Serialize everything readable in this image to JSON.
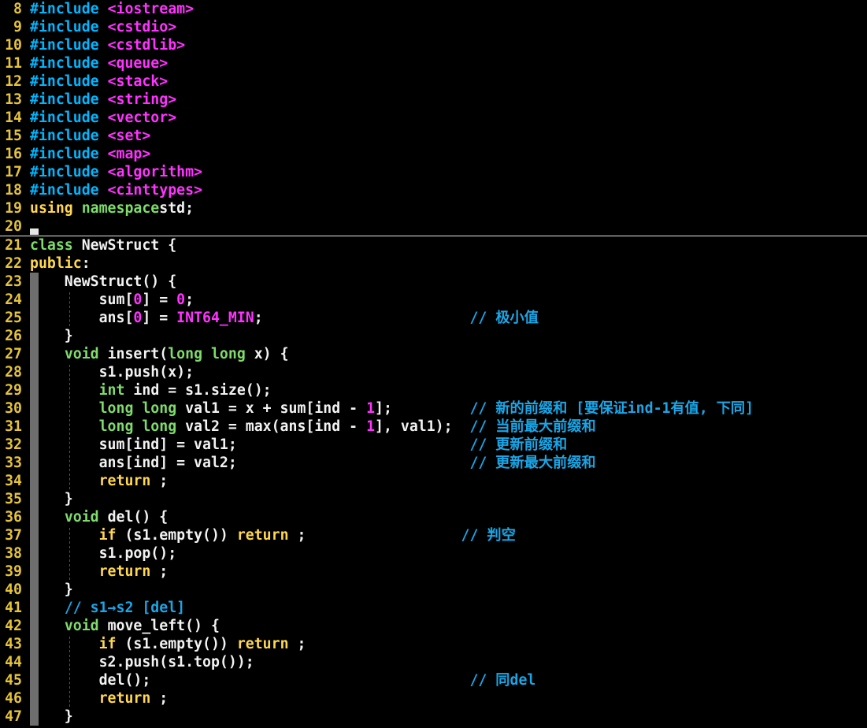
{
  "colors": {
    "background": "#000000",
    "line_number": "#e5c33a",
    "text": "#f2f2f2",
    "preprocessor": "#00b7ff",
    "include_target": "#ff33ff",
    "keyword": "#ffd750",
    "type": "#7fdc6a",
    "number": "#ff33ff",
    "comment": "#1aa6e6"
  },
  "lines": [
    {
      "n": "8",
      "t": [
        [
          "pre",
          "#include "
        ],
        [
          "inc",
          "<iostream>"
        ]
      ]
    },
    {
      "n": "9",
      "t": [
        [
          "pre",
          "#include "
        ],
        [
          "inc",
          "<cstdio>"
        ]
      ]
    },
    {
      "n": "10",
      "t": [
        [
          "pre",
          "#include "
        ],
        [
          "inc",
          "<cstdlib>"
        ]
      ]
    },
    {
      "n": "11",
      "t": [
        [
          "pre",
          "#include "
        ],
        [
          "inc",
          "<queue>"
        ]
      ]
    },
    {
      "n": "12",
      "t": [
        [
          "pre",
          "#include "
        ],
        [
          "inc",
          "<stack>"
        ]
      ]
    },
    {
      "n": "13",
      "t": [
        [
          "pre",
          "#include "
        ],
        [
          "inc",
          "<string>"
        ]
      ]
    },
    {
      "n": "14",
      "t": [
        [
          "pre",
          "#include "
        ],
        [
          "inc",
          "<vector>"
        ]
      ]
    },
    {
      "n": "15",
      "t": [
        [
          "pre",
          "#include "
        ],
        [
          "inc",
          "<set>"
        ]
      ]
    },
    {
      "n": "16",
      "t": [
        [
          "pre",
          "#include "
        ],
        [
          "inc",
          "<map>"
        ]
      ]
    },
    {
      "n": "17",
      "t": [
        [
          "pre",
          "#include "
        ],
        [
          "inc",
          "<algorithm>"
        ]
      ]
    },
    {
      "n": "18",
      "t": [
        [
          "pre",
          "#include "
        ],
        [
          "inc",
          "<cinttypes>"
        ]
      ]
    },
    {
      "n": "19",
      "t": [
        [
          "kw",
          "using "
        ],
        [
          "ty",
          "namespace"
        ],
        [
          "",
          "std;"
        ]
      ]
    },
    {
      "n": "20",
      "t": [],
      "cursor": true
    },
    {
      "n": "21",
      "t": [
        [
          "ty",
          "class "
        ],
        [
          "",
          "NewStruct {"
        ]
      ]
    },
    {
      "n": "22",
      "t": [
        [
          "kw",
          "public"
        ],
        [
          "",
          ":"
        ]
      ]
    },
    {
      "n": "23",
      "t": [
        [
          "",
          "    NewStruct() {"
        ]
      ],
      "bar": true
    },
    {
      "n": "24",
      "t": [
        [
          "",
          "        sum["
        ],
        [
          "num",
          "0"
        ],
        [
          "",
          "] = "
        ],
        [
          "num",
          "0"
        ],
        [
          "",
          ";"
        ]
      ],
      "bar": true,
      "guide": true
    },
    {
      "n": "25",
      "t": [
        [
          "",
          "        ans["
        ],
        [
          "num",
          "0"
        ],
        [
          "",
          "] = "
        ],
        [
          "const",
          "INT64_MIN"
        ],
        [
          "",
          ";                        "
        ],
        [
          "cmt",
          "// 极小值"
        ]
      ],
      "bar": true,
      "guide": true
    },
    {
      "n": "26",
      "t": [
        [
          "",
          "    }"
        ]
      ],
      "bar": true
    },
    {
      "n": "27",
      "t": [
        [
          "",
          "    "
        ],
        [
          "ty",
          "void "
        ],
        [
          "",
          "insert("
        ],
        [
          "ty",
          "long long "
        ],
        [
          "",
          "x) {"
        ]
      ],
      "bar": true
    },
    {
      "n": "28",
      "t": [
        [
          "",
          "        s1.push(x);"
        ]
      ],
      "bar": true,
      "guide": true
    },
    {
      "n": "29",
      "t": [
        [
          "",
          "        "
        ],
        [
          "ty",
          "int "
        ],
        [
          "",
          "ind = s1.size();"
        ]
      ],
      "bar": true,
      "guide": true
    },
    {
      "n": "30",
      "t": [
        [
          "",
          "        "
        ],
        [
          "ty",
          "long long "
        ],
        [
          "",
          "val1 = x + sum[ind - "
        ],
        [
          "num",
          "1"
        ],
        [
          "",
          "];         "
        ],
        [
          "cmt",
          "// 新的前缀和 [要保证ind-1有值, 下同]"
        ]
      ],
      "bar": true,
      "guide": true
    },
    {
      "n": "31",
      "t": [
        [
          "",
          "        "
        ],
        [
          "ty",
          "long long "
        ],
        [
          "",
          "val2 = max(ans[ind - "
        ],
        [
          "num",
          "1"
        ],
        [
          "",
          "], val1);  "
        ],
        [
          "cmt",
          "// 当前最大前缀和"
        ]
      ],
      "bar": true,
      "guide": true
    },
    {
      "n": "32",
      "t": [
        [
          "",
          "        sum[ind] = val1;                           "
        ],
        [
          "cmt",
          "// 更新前缀和"
        ]
      ],
      "bar": true,
      "guide": true
    },
    {
      "n": "33",
      "t": [
        [
          "",
          "        ans[ind] = val2;                           "
        ],
        [
          "cmt",
          "// 更新最大前缀和"
        ]
      ],
      "bar": true,
      "guide": true
    },
    {
      "n": "34",
      "t": [
        [
          "",
          "        "
        ],
        [
          "kw",
          "return "
        ],
        [
          "",
          ";"
        ]
      ],
      "bar": true,
      "guide": true
    },
    {
      "n": "35",
      "t": [
        [
          "",
          "    }"
        ]
      ],
      "bar": true
    },
    {
      "n": "36",
      "t": [
        [
          "",
          "    "
        ],
        [
          "ty",
          "void "
        ],
        [
          "",
          "del() {"
        ]
      ],
      "bar": true
    },
    {
      "n": "37",
      "t": [
        [
          "",
          "        "
        ],
        [
          "kw",
          "if "
        ],
        [
          "",
          "(s1.empty()) "
        ],
        [
          "kw",
          "return "
        ],
        [
          "",
          ";                  "
        ],
        [
          "cmt",
          "// 判空"
        ]
      ],
      "bar": true,
      "guide": true
    },
    {
      "n": "38",
      "t": [
        [
          "",
          "        s1.pop();"
        ]
      ],
      "bar": true,
      "guide": true
    },
    {
      "n": "39",
      "t": [
        [
          "",
          "        "
        ],
        [
          "kw",
          "return "
        ],
        [
          "",
          ";"
        ]
      ],
      "bar": true,
      "guide": true
    },
    {
      "n": "40",
      "t": [
        [
          "",
          "    }"
        ]
      ],
      "bar": true
    },
    {
      "n": "41",
      "t": [
        [
          "",
          "    "
        ],
        [
          "cmt",
          "// s1→s2 [del]"
        ]
      ],
      "bar": true
    },
    {
      "n": "42",
      "t": [
        [
          "",
          "    "
        ],
        [
          "ty",
          "void "
        ],
        [
          "",
          "move_left() {"
        ]
      ],
      "bar": true
    },
    {
      "n": "43",
      "t": [
        [
          "",
          "        "
        ],
        [
          "kw",
          "if "
        ],
        [
          "",
          "(s1.empty()) "
        ],
        [
          "kw",
          "return "
        ],
        [
          "",
          ";"
        ]
      ],
      "bar": true,
      "guide": true
    },
    {
      "n": "44",
      "t": [
        [
          "",
          "        s2.push(s1.top());"
        ]
      ],
      "bar": true,
      "guide": true
    },
    {
      "n": "45",
      "t": [
        [
          "",
          "        del();                                     "
        ],
        [
          "cmt",
          "// 同del"
        ]
      ],
      "bar": true,
      "guide": true
    },
    {
      "n": "46",
      "t": [
        [
          "",
          "        "
        ],
        [
          "kw",
          "return "
        ],
        [
          "",
          ";"
        ]
      ],
      "bar": true,
      "guide": true
    },
    {
      "n": "47",
      "t": [
        [
          "",
          "    }"
        ]
      ],
      "bar": true
    }
  ]
}
